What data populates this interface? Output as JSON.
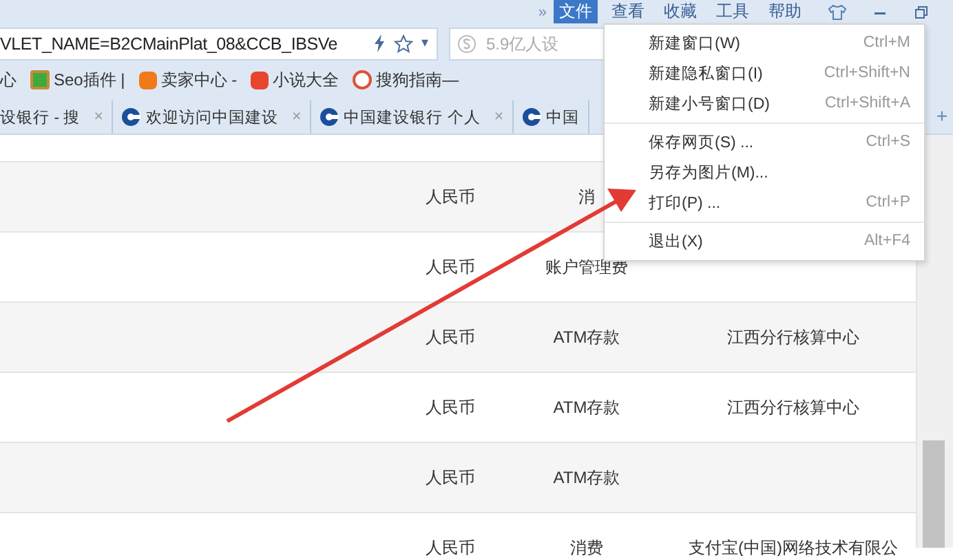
{
  "menubar": {
    "overflow": "»",
    "items": [
      {
        "label": "文件",
        "selected": true
      },
      {
        "label": "查看",
        "selected": false
      },
      {
        "label": "收藏",
        "selected": false
      },
      {
        "label": "工具",
        "selected": false
      },
      {
        "label": "帮助",
        "selected": false
      }
    ]
  },
  "address_bar": {
    "url": "VLET_NAME=B2CMainPlat_08&CCB_IBSVe",
    "dropdown": "▾"
  },
  "search": {
    "placeholder": "5.9亿人设"
  },
  "bookmarks": [
    {
      "label": "心",
      "kind": "text"
    },
    {
      "label": "Seo插件 |",
      "kind": "green"
    },
    {
      "label": "卖家中心 -",
      "kind": "shop"
    },
    {
      "label": "小说大全",
      "kind": "book"
    },
    {
      "label": "搜狗指南—",
      "kind": "sogou"
    }
  ],
  "tabs": [
    {
      "label": "设银行 - 搜",
      "close": "×",
      "icon": false
    },
    {
      "label": "欢迎访问中国建设",
      "close": "×",
      "icon": true
    },
    {
      "label": "中国建设银行 个人",
      "close": "×",
      "icon": true
    },
    {
      "label": "中国",
      "icon": true
    }
  ],
  "new_tab": "+",
  "file_menu": [
    {
      "label": "新建窗口(W)",
      "shortcut": "Ctrl+M",
      "separator_before": false
    },
    {
      "label": "新建隐私窗口(I)",
      "shortcut": "Ctrl+Shift+N",
      "separator_before": false
    },
    {
      "label": "新建小号窗口(D)",
      "shortcut": "Ctrl+Shift+A",
      "separator_before": false
    },
    {
      "label": "保存网页(S) ...",
      "shortcut": "Ctrl+S",
      "separator_before": true
    },
    {
      "label": "另存为图片(M)...",
      "separator_before": false
    },
    {
      "label": "打印(P) ...",
      "shortcut": "Ctrl+P",
      "separator_before": false
    },
    {
      "label": "退出(X)",
      "shortcut": "Alt+F4",
      "separator_before": true
    }
  ],
  "table": {
    "rows": [
      [
        "人民币",
        "消",
        ""
      ],
      [
        "人民币",
        "账户管理费",
        ""
      ],
      [
        "人民币",
        "ATM存款",
        "江西分行核算中心"
      ],
      [
        "人民币",
        "ATM存款",
        "江西分行核算中心"
      ],
      [
        "人民币",
        "ATM存款",
        ""
      ],
      [
        "人民币",
        "消费",
        "支付宝(中国)网络技术有限公"
      ]
    ]
  }
}
